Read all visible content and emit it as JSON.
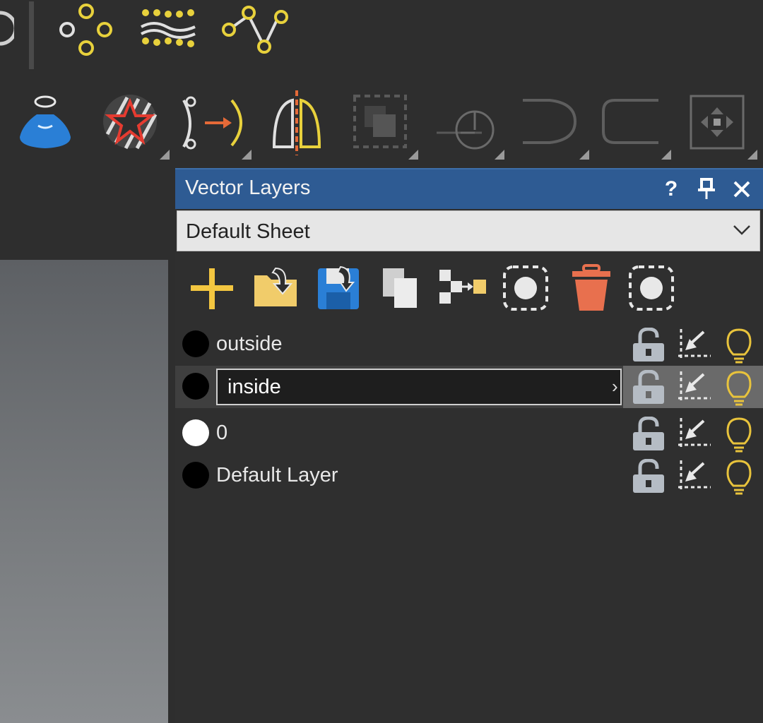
{
  "panel": {
    "title": "Vector Layers",
    "help_label": "?",
    "pin_label": "❘",
    "close_label": "✕",
    "sheet": {
      "selected": "Default Sheet"
    }
  },
  "toolbar": {
    "icons": [
      "control-points-icon",
      "texture-dots-icon",
      "polyline-nodes-icon",
      "inflate-icon",
      "stamp-star-icon",
      "convert-path-icon",
      "mirror-icon",
      "group-icon",
      "revolve-icon",
      "arc-icon",
      "fillet-icon",
      "transform-icon"
    ]
  },
  "actions": {
    "icons": [
      "add-layer-icon",
      "import-layer-icon",
      "save-layer-icon",
      "copy-layer-icon",
      "merge-layer-icon",
      "select-layer-icon",
      "delete-layer-icon",
      "select-all-layer-icon"
    ]
  },
  "layers": [
    {
      "name": "outside",
      "dot": "black"
    },
    {
      "name": "inside",
      "dot": "black",
      "editing": true
    },
    {
      "name": "0",
      "dot": "white"
    },
    {
      "name": "Default Layer",
      "dot": "black"
    }
  ],
  "rename": {
    "value": "inside",
    "arrow": "›"
  },
  "colors": {
    "titlebar": "#2e5b93",
    "panel": "#2f2f2f",
    "accent_yellow": "#e8c33c",
    "delete_orange": "#e8704e",
    "lock_gray": "#b5bcc4"
  }
}
